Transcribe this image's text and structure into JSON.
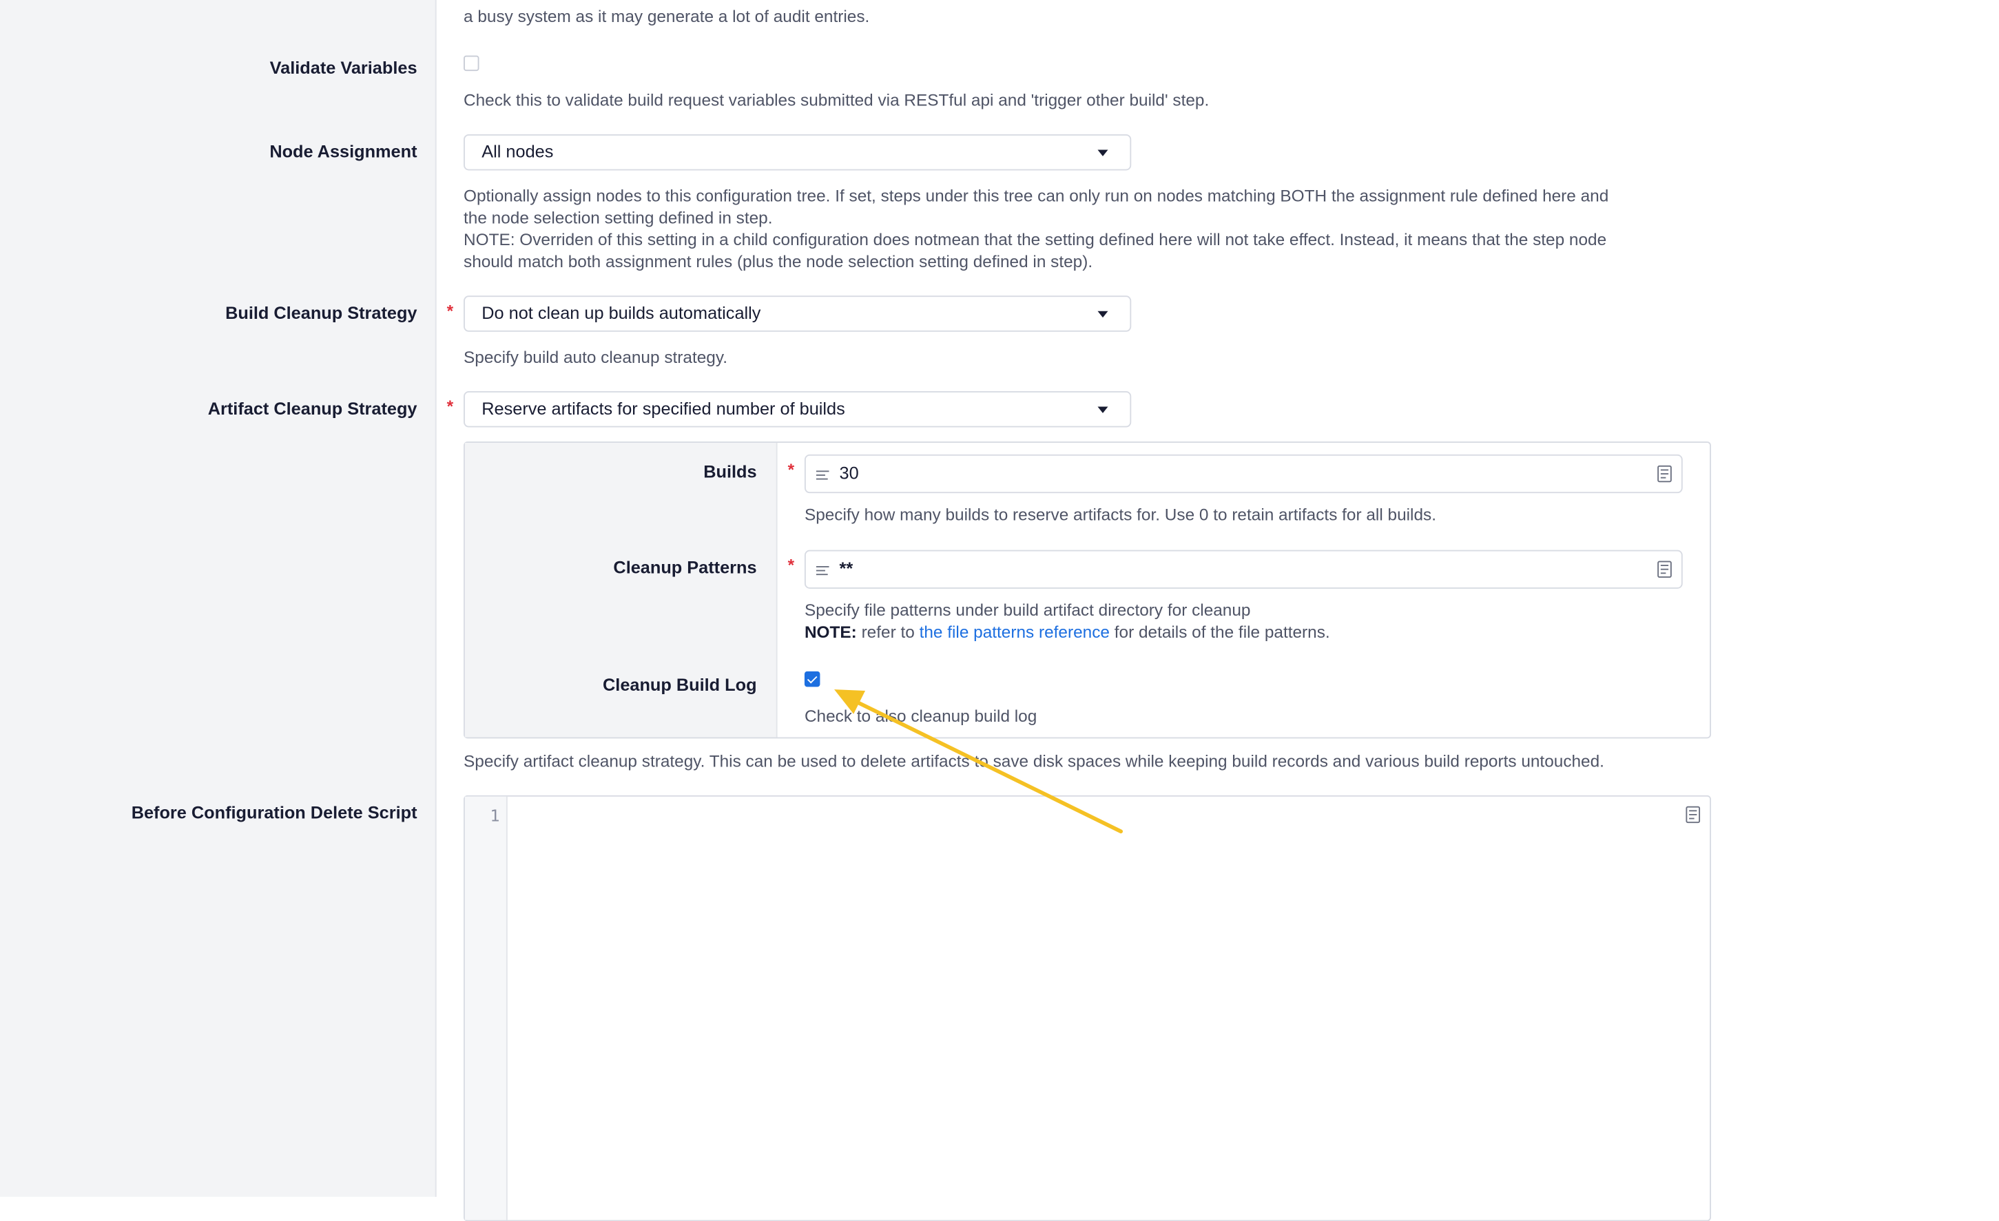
{
  "top_help_tail": "a busy system as it may generate a lot of audit entries.",
  "validate_variables": {
    "label": "Validate Variables",
    "checked": false,
    "help": "Check this to validate build request variables submitted via RESTful api and 'trigger other build' step."
  },
  "node_assignment": {
    "label": "Node Assignment",
    "value": "All nodes",
    "help_line1": "Optionally assign nodes to this configuration tree. If set, steps under this tree can only run on nodes matching BOTH the assignment rule defined here and",
    "help_line2": "the node selection setting defined in step.",
    "help_line3": "NOTE: Overriden of this setting in a child configuration does notmean that the setting defined here will not take effect. Instead, it means that the step node",
    "help_line4": "should match both assignment rules (plus the node selection setting defined in step)."
  },
  "build_cleanup": {
    "label": "Build Cleanup Strategy",
    "required": "*",
    "value": "Do not clean up builds automatically",
    "help": "Specify build auto cleanup strategy."
  },
  "artifact_cleanup": {
    "label": "Artifact Cleanup Strategy",
    "required": "*",
    "value": "Reserve artifacts for specified number of builds",
    "help": "Specify artifact cleanup strategy. This can be used to delete artifacts to save disk spaces while keeping build records and various build reports untouched.",
    "builds": {
      "label": "Builds",
      "required": "*",
      "value": "30",
      "help": "Specify how many builds to reserve artifacts for. Use 0 to retain artifacts for all builds."
    },
    "cleanup_patterns": {
      "label": "Cleanup Patterns",
      "required": "*",
      "value": "**",
      "help_line1": "Specify file patterns under build artifact directory for cleanup",
      "note_label": "NOTE:",
      "note_pre": "refer to",
      "note_link": "the file patterns reference",
      "note_post": "for details of the file patterns."
    },
    "cleanup_build_log": {
      "label": "Cleanup Build Log",
      "checked": true,
      "help": "Check to also cleanup build log"
    }
  },
  "before_delete_script": {
    "label": "Before Configuration Delete Script",
    "line_number": "1"
  },
  "colors": {
    "accent": "#1d6fe0",
    "required": "#e0303b",
    "arrow": "#f5c124"
  }
}
